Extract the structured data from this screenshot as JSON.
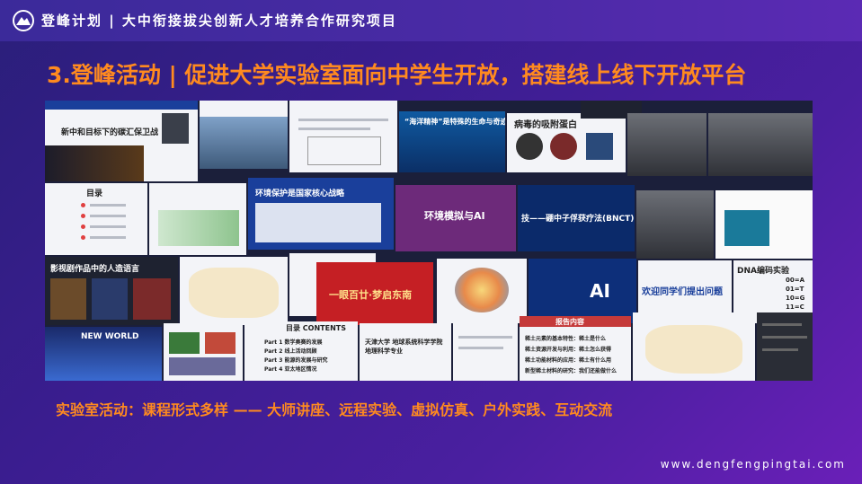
{
  "header": {
    "title": "登峰计划 | 大中衔接拔尖创新人才培养合作研究项目"
  },
  "headline": "3.登峰活动 | 促进大学实验室面向中学生开放，搭建线上线下开放平台",
  "collage": {
    "captions": {
      "t1": "新中和目标下的碳汇保卫战",
      "t4": "“海洋精神”是特殊的生命与奇迹",
      "t5": "病毒的吸附蛋白",
      "t9": "环境保护是国家核心战略",
      "t10": "环境模拟与AI",
      "t11": "技——硼中子俘获疗法(BNCT)",
      "t14": "影视剧作品中的人造语言",
      "t17": "一眼百廿·梦启东南",
      "t19": "AI",
      "t20": "欢迎同学们提出问题",
      "t21": "DNA编码实验",
      "t22": "NEW WORLD",
      "t24": "目录 CONTENTS",
      "t25": "天津大学 地球系统科学学院 地理科学专业",
      "t27": "报告内容",
      "t8": "目录"
    },
    "list_items_t27": [
      "稀土元素的基本特性：稀土是什么",
      "稀土资源开发与利用：稀土怎么获得",
      "稀土功能材料的应用：稀土有什么用",
      "新型稀土材料的研究：我们还能做什么"
    ],
    "list_items_t24": [
      "Part 1 数学奥赛的发展",
      "Part 2 线上活动回顾",
      "Part 3 能源的发展与研究",
      "Part 4 亚太地区情况"
    ],
    "dna_codes": [
      "00=A",
      "01=T",
      "10=G",
      "11=C"
    ]
  },
  "subtitle": "实验室活动：课程形式多样 —— 大师讲座、远程实验、虚拟仿真、户外实践、互动交流",
  "footer": {
    "url": "www.dengfengpingtai.com"
  },
  "colors": {
    "accent": "#ff8a1f",
    "background": "#3a1d8f"
  }
}
